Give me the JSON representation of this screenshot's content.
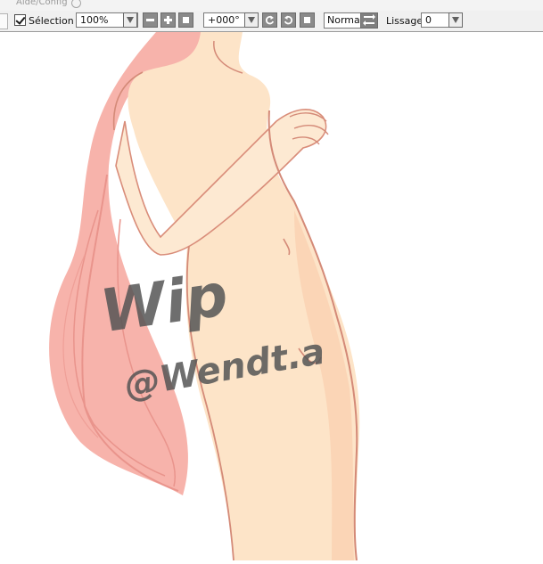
{
  "menu": {
    "item_label": "Aide/Config"
  },
  "toolbar": {
    "selection_label": "Sélection",
    "selection_checked": true,
    "zoom_value": "100%",
    "rotation_value": "+000°",
    "blend_mode": "Normal",
    "smoothing_label": "Lissage",
    "smoothing_value": "0"
  },
  "canvas": {
    "watermark_line1": "Wip",
    "watermark_line2": "@Wendt.a",
    "colors": {
      "skin": "#fde6cc",
      "skin_shadow": "#f9d3b4",
      "hair": "#f7a8a2",
      "outline": "#d48a78",
      "watermark": "#555555"
    }
  }
}
